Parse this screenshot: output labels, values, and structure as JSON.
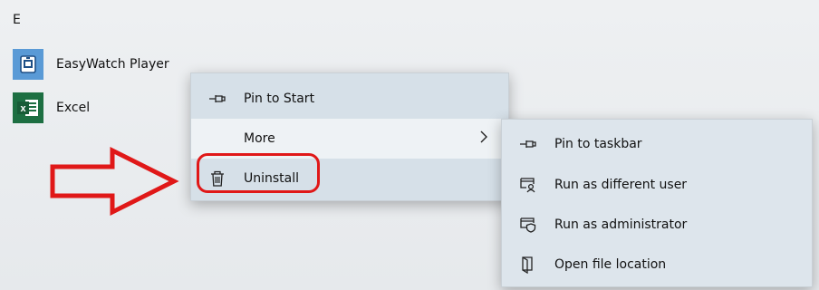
{
  "start_menu": {
    "group_letter": "E",
    "apps": [
      {
        "label": "EasyWatch Player",
        "icon": "easywatch-app-icon"
      },
      {
        "label": "Excel",
        "icon": "excel-app-icon"
      }
    ]
  },
  "context_menu": {
    "items": [
      {
        "label": "Pin to Start",
        "icon": "pin-icon"
      },
      {
        "label": "More",
        "icon": "",
        "submenu_indicator": "chevron-right-icon"
      },
      {
        "label": "Uninstall",
        "icon": "trash-icon"
      }
    ]
  },
  "more_submenu": {
    "items": [
      {
        "label": "Pin to taskbar",
        "icon": "pin-icon"
      },
      {
        "label": "Run as different user",
        "icon": "user-window-icon"
      },
      {
        "label": "Run as administrator",
        "icon": "shield-window-icon"
      },
      {
        "label": "Open file location",
        "icon": "folder-icon"
      }
    ]
  },
  "annotation": {
    "color": "#e01818",
    "arrow": "pointing-right-arrow",
    "target": "Uninstall"
  },
  "colors": {
    "excel_green": "#1d6f42",
    "easywatch_blue": "#5a9ad6"
  }
}
